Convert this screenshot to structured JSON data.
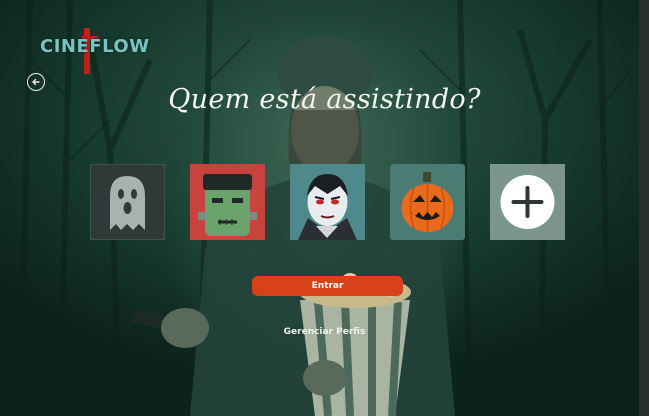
{
  "app": {
    "logo_text": "CINEFLOW"
  },
  "header": {
    "title": "Quem está assistindo?"
  },
  "profiles": [
    {
      "name": "ghost"
    },
    {
      "name": "frankenstein"
    },
    {
      "name": "vampire"
    },
    {
      "name": "pumpkin"
    },
    {
      "name": "add-profile"
    }
  ],
  "actions": {
    "enter_label": "Entrar",
    "manage_label": "Gerenciar Perfis"
  },
  "icons": {
    "back": "back-arrow-icon",
    "add": "plus-icon"
  },
  "colors": {
    "accent": "#d7421a",
    "logo": "#79c4c1",
    "background": "#173a2f"
  }
}
